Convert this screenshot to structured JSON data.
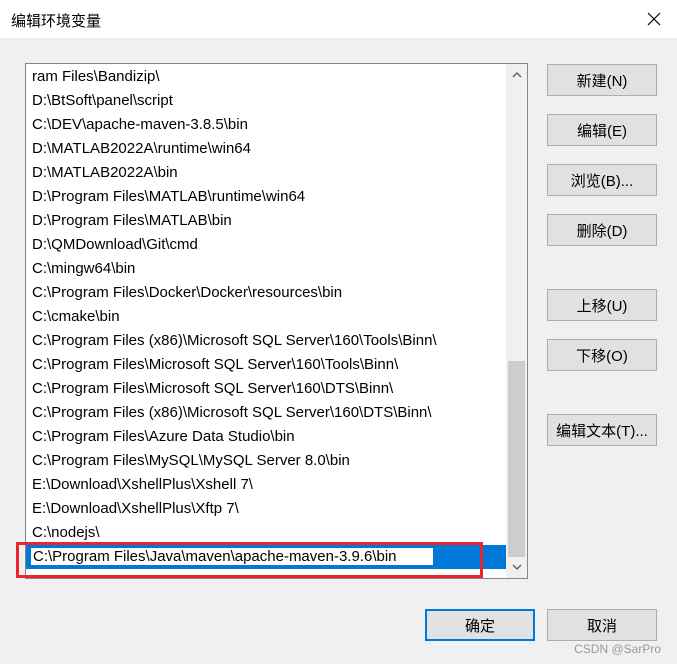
{
  "window": {
    "title": "编辑环境变量"
  },
  "path_list": {
    "items": [
      "ram Files\\Bandizip\\",
      "D:\\BtSoft\\panel\\script",
      "C:\\DEV\\apache-maven-3.8.5\\bin",
      "D:\\MATLAB2022A\\runtime\\win64",
      "D:\\MATLAB2022A\\bin",
      "D:\\Program Files\\MATLAB\\runtime\\win64",
      "D:\\Program Files\\MATLAB\\bin",
      "D:\\QMDownload\\Git\\cmd",
      "C:\\mingw64\\bin",
      "C:\\Program Files\\Docker\\Docker\\resources\\bin",
      "C:\\cmake\\bin",
      "C:\\Program Files (x86)\\Microsoft SQL Server\\160\\Tools\\Binn\\",
      "C:\\Program Files\\Microsoft SQL Server\\160\\Tools\\Binn\\",
      "C:\\Program Files\\Microsoft SQL Server\\160\\DTS\\Binn\\",
      "C:\\Program Files (x86)\\Microsoft SQL Server\\160\\DTS\\Binn\\",
      "C:\\Program Files\\Azure Data Studio\\bin",
      "C:\\Program Files\\MySQL\\MySQL Server 8.0\\bin",
      "E:\\Download\\XshellPlus\\Xshell 7\\",
      "E:\\Download\\XshellPlus\\Xftp 7\\",
      "C:\\nodejs\\"
    ],
    "editing_value": "C:\\Program Files\\Java\\maven\\apache-maven-3.9.6\\bin"
  },
  "buttons": {
    "new": "新建(N)",
    "edit": "编辑(E)",
    "browse": "浏览(B)...",
    "delete": "删除(D)",
    "move_up": "上移(U)",
    "move_down": "下移(O)",
    "edit_text": "编辑文本(T)...",
    "ok": "确定",
    "cancel": "取消"
  },
  "watermark": "CSDN @SarPro",
  "colors": {
    "selection": "#0078d7",
    "highlight_box": "#e8272b"
  }
}
